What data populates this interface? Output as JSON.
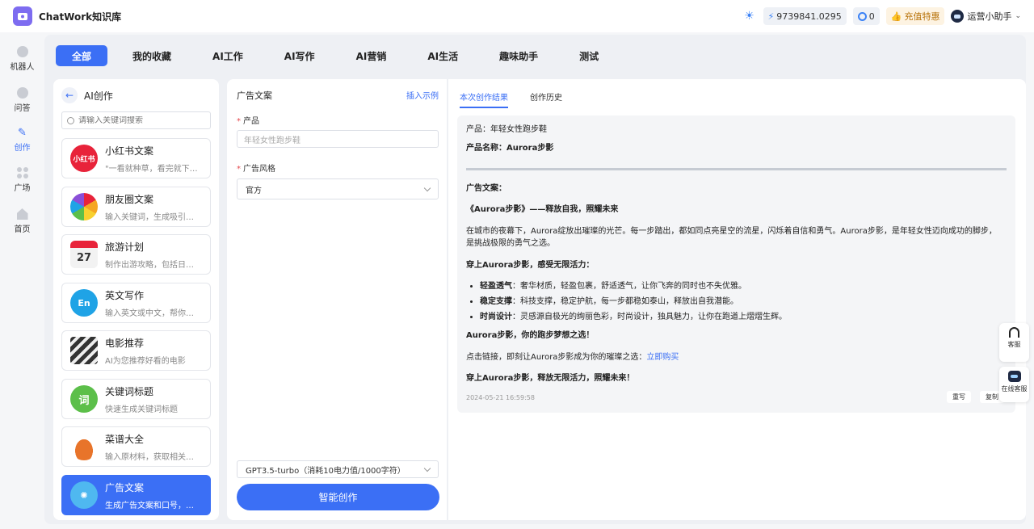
{
  "app": {
    "title": "ChatWork知识库"
  },
  "topbar": {
    "balance": "9739841.0295",
    "coins": "0",
    "vip_label": "充值特惠",
    "user_name": "运营小助手"
  },
  "rail": [
    {
      "label": "机器人",
      "icon": "robot-icon"
    },
    {
      "label": "问答",
      "icon": "chat-icon"
    },
    {
      "label": "创作",
      "icon": "pen-icon"
    },
    {
      "label": "广场",
      "icon": "grid-icon"
    },
    {
      "label": "首页",
      "icon": "home-icon"
    }
  ],
  "tabs": [
    "全部",
    "我的收藏",
    "AI工作",
    "AI写作",
    "AI营销",
    "AI生活",
    "趣味助手",
    "测试"
  ],
  "catalog": {
    "title": "AI创作",
    "search_placeholder": "请输入关键词搜索",
    "items": [
      {
        "name": "小红书文案",
        "desc": "\"一看就种草，看完就下单...",
        "icon": "xiaohongshu-icon",
        "color": "#e8233a",
        "glyph": "小红书"
      },
      {
        "name": "朋友圈文案",
        "desc": "输入关键词，生成吸引人...",
        "icon": "pinwheel-icon",
        "color": "#f5a623",
        "glyph": ""
      },
      {
        "name": "旅游计划",
        "desc": "制作出游攻略，包括日期...",
        "icon": "calendar-icon",
        "color": "#eeeeee",
        "glyph": "27"
      },
      {
        "name": "英文写作",
        "desc": "输入英文或中文，帮你润...",
        "icon": "en-icon",
        "color": "#1fa3e6",
        "glyph": "En"
      },
      {
        "name": "电影推荐",
        "desc": "AI为您推荐好看的电影",
        "icon": "clapperboard-icon",
        "color": "#333333",
        "glyph": ""
      },
      {
        "name": "关键词标题",
        "desc": "快速生成关键词标题",
        "icon": "word-icon",
        "color": "#5cbf4a",
        "glyph": "词"
      },
      {
        "name": "菜谱大全",
        "desc": "输入原材料，获取相关菜...",
        "icon": "pot-icon",
        "color": "#e8742a",
        "glyph": ""
      },
      {
        "name": "广告文案",
        "desc": "生成广告文案和口号，选...",
        "icon": "ad-icon",
        "color": "#4fb8f0",
        "glyph": ""
      }
    ]
  },
  "form": {
    "title": "广告文案",
    "insert_example": "插入示例",
    "product_label": "产品",
    "product_placeholder": "年轻女性跑步鞋",
    "style_label": "广告风格",
    "style_value": "官方",
    "model_value": "GPT3.5-turbo（消耗10电力值/1000字符）",
    "generate_label": "智能创作"
  },
  "result": {
    "tabs": [
      "本次创作结果",
      "创作历史"
    ],
    "product_line": "产品：年轻女性跑步鞋",
    "name_line": "产品名称：Aurora步影",
    "copy_label": "广告文案：",
    "headline": "《Aurora步影》——释放自我，照耀未来",
    "para1_a": "在城市的夜幕下，Aurora绽放出璀璨的光芒。每一步踏出，都如同点亮星空的流星，闪烁着自信和勇气。Aurora步影，是年轻女性迈向成功的脚步，",
    "para1_b": "是挑战极限的勇气之选。",
    "subhead": "穿上Aurora步影，感受无限活力：",
    "bullets": [
      {
        "term": "轻盈透气",
        "text": "：奢华材质，轻盈包裹，舒适透气，让你飞奔的同时也不失优雅。"
      },
      {
        "term": "稳定支撑",
        "text": "：科技支撑，稳定护航，每一步都稳如泰山，释放出自我潜能。"
      },
      {
        "term": "时尚设计",
        "text": "：灵感源自极光的绚丽色彩，时尚设计，独具魅力，让你在跑道上熠熠生辉。"
      }
    ],
    "dream_line": "Aurora步影，你的跑步梦想之选！",
    "cta_text": "点击链接，即刻让Aurora步影成为你的璀璨之选：",
    "cta_link": "立即购买",
    "closing": "穿上Aurora步影，释放无限活力，照耀未来！",
    "timestamp": "2024-05-21 16:59:58",
    "rewrite_label": "重写",
    "copy_btn_label": "复制"
  },
  "float": {
    "service_label": "客服",
    "online_label": "在线客服"
  }
}
